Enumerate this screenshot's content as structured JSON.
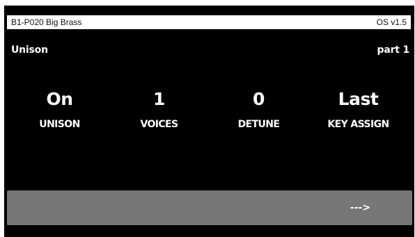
{
  "status_bar": {
    "patch_name": "B1-P020 Big Brass",
    "os_version": "OS v1.5"
  },
  "page": {
    "title": "Unison",
    "part": "part 1"
  },
  "params": [
    {
      "value": "On",
      "label": "UNISON"
    },
    {
      "value": "1",
      "label": "VOICES"
    },
    {
      "value": "0",
      "label": "DETUNE"
    },
    {
      "value": "Last",
      "label": "KEY ASSIGN"
    }
  ],
  "softkeys": [
    {
      "label": ""
    },
    {
      "label": ""
    },
    {
      "label": ""
    },
    {
      "label": "--->"
    }
  ],
  "colors": {
    "screen_bg": "#000000",
    "text": "#ffffff",
    "status_bar_bg": "#ffffff",
    "softkey_bg": "#777777"
  }
}
